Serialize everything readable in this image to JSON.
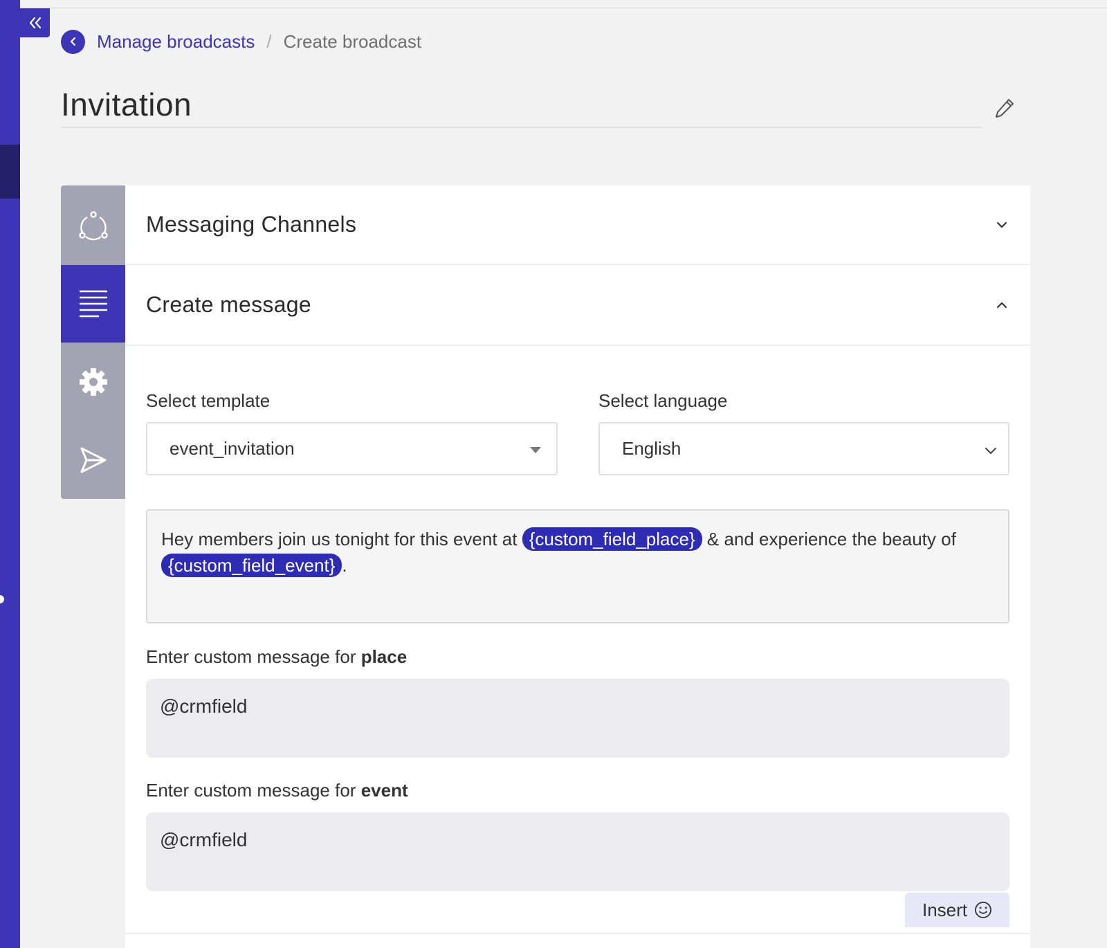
{
  "icons": {
    "collapse": "double-chevron-left-icon",
    "back": "chevron-left-icon",
    "edit": "pencil-icon",
    "channels": "channels-network-icon",
    "message": "text-lines-icon",
    "settings": "gear-icon",
    "send": "send-icon",
    "expand": "chevron-down-icon",
    "collapse_section": "chevron-up-icon",
    "emoji": "smiley-icon"
  },
  "colors": {
    "accent": "#3d35b5",
    "accent_dark": "#25216a",
    "chip": "#2e2bb5",
    "step_inactive": "#a3a3b4",
    "page_bg": "#f2f2f2",
    "input_bg": "#ebebf0"
  },
  "breadcrumb": {
    "parent": "Manage broadcasts",
    "separator": "/",
    "current": "Create broadcast"
  },
  "page_title": "Invitation",
  "sections": {
    "messaging_channels": "Messaging Channels",
    "create_message": "Create message"
  },
  "form": {
    "template_label": "Select template",
    "template_value": "event_invitation",
    "language_label": "Select language",
    "language_value": "English"
  },
  "preview": {
    "text_before": "Hey members join us tonight for this event at ",
    "chip_place": "{custom_field_place}",
    "text_middle": "  & and experience the beauty of ",
    "chip_event": "{custom_field_event}",
    "text_end": "."
  },
  "custom_place": {
    "label_prefix": "Enter custom message for ",
    "label_field": "place",
    "value": "@crmfield"
  },
  "custom_event": {
    "label_prefix": "Enter custom message for ",
    "label_field": "event",
    "value": "@crmfield"
  },
  "insert_label": "Insert"
}
